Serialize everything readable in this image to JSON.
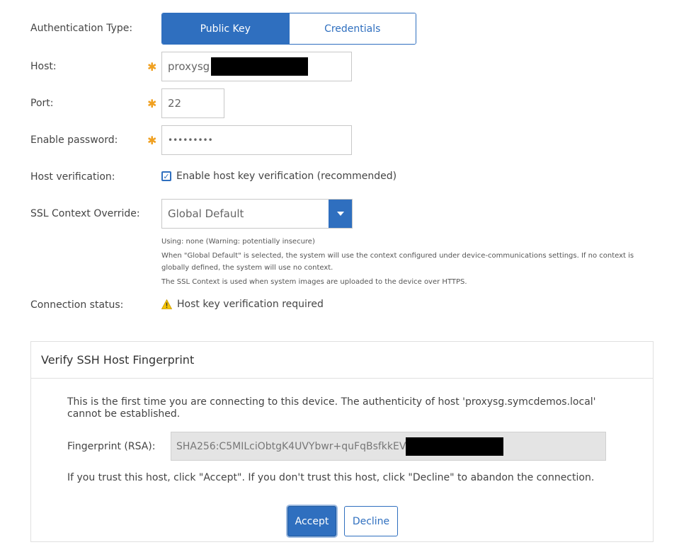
{
  "auth": {
    "label": "Authentication Type:",
    "options": [
      "Public Key",
      "Credentials"
    ],
    "selected": "Public Key"
  },
  "host": {
    "label": "Host:",
    "value": "proxysg"
  },
  "port": {
    "label": "Port:",
    "value": "22"
  },
  "enable_password": {
    "label": "Enable password:",
    "value": "•••••••••"
  },
  "host_verification": {
    "label": "Host verification:",
    "checkbox_label": "Enable host key verification (recommended)",
    "checked": true
  },
  "ssl": {
    "label": "SSL Context Override:",
    "value": "Global Default",
    "help": [
      "Using: none (Warning: potentially insecure)",
      "When \"Global Default\" is selected, the system will use the context configured under device-communications settings. If no context is globally defined, the system will use no context.",
      "The SSL Context is used when system images are uploaded to the device over HTTPS."
    ]
  },
  "connection": {
    "label": "Connection status:",
    "status": "Host key verification required"
  },
  "dialog": {
    "title": "Verify SSH Host Fingerprint",
    "message": "This is the first time you are connecting to this device. The authenticity of host 'proxysg.symcdemos.local' cannot be established.",
    "fingerprint_label": "Fingerprint (RSA):",
    "fingerprint_value": "SHA256:C5MILciObtgK4UVYbwr+quFqBsfkkEV",
    "trust_message": "If you trust this host, click \"Accept\". If you don't trust this host, click \"Decline\" to abandon the connection.",
    "accept_label": "Accept",
    "decline_label": "Decline"
  },
  "colors": {
    "accent": "#2f6fbf",
    "required": "#f0a020",
    "warning": "#f5c400"
  },
  "icons": {
    "required": "asterisk-icon",
    "checkbox": "checkmark-icon",
    "select": "chevron-down-icon",
    "status": "warning-icon"
  }
}
